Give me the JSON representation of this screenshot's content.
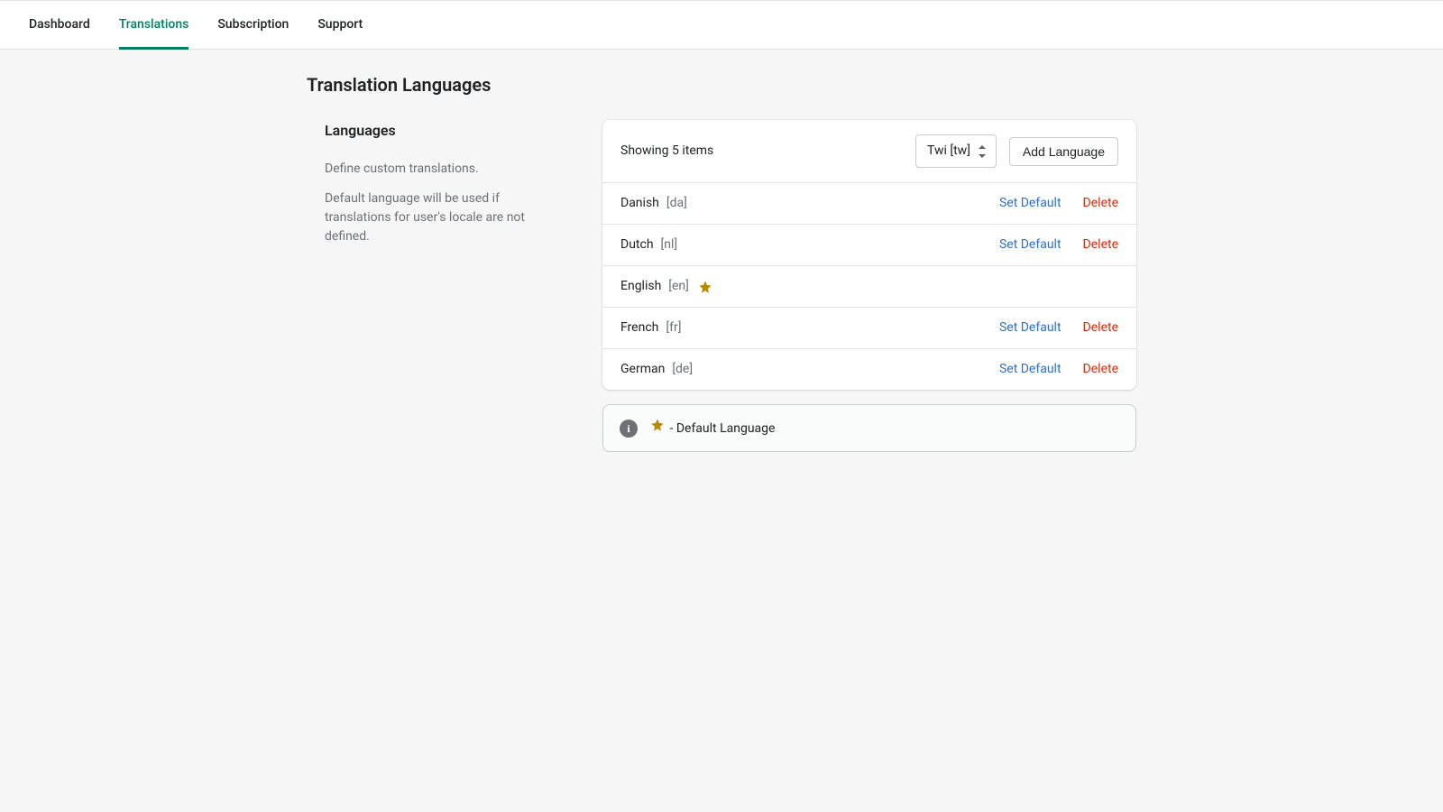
{
  "nav": {
    "items": [
      {
        "label": "Dashboard",
        "active": false
      },
      {
        "label": "Translations",
        "active": true
      },
      {
        "label": "Subscription",
        "active": false
      },
      {
        "label": "Support",
        "active": false
      }
    ]
  },
  "page": {
    "title": "Translation Languages"
  },
  "side": {
    "title": "Languages",
    "desc1": "Define custom translations.",
    "desc2": "Default language will be used if translations for user's locale are not defined."
  },
  "table": {
    "showing_label": "Showing 5 items",
    "select_value": "Twi [tw]",
    "add_button": "Add Language",
    "set_default_label": "Set Default",
    "delete_label": "Delete",
    "rows": [
      {
        "name": "Danish",
        "code": "[da]",
        "is_default": false
      },
      {
        "name": "Dutch",
        "code": "[nl]",
        "is_default": false
      },
      {
        "name": "English",
        "code": "[en]",
        "is_default": true
      },
      {
        "name": "French",
        "code": "[fr]",
        "is_default": false
      },
      {
        "name": "German",
        "code": "[de]",
        "is_default": false
      }
    ]
  },
  "legend": {
    "text": "- Default Language"
  }
}
